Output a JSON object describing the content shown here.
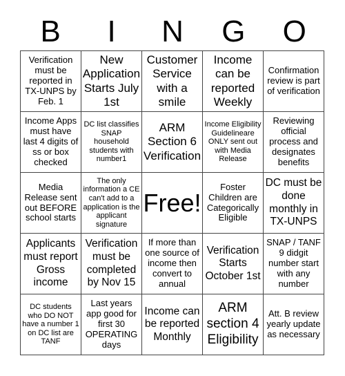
{
  "header": [
    "B",
    "I",
    "N",
    "G",
    "O"
  ],
  "cells": [
    "Verification must be reported in TX-UNPS by Feb. 1",
    "New Application Starts July 1st",
    "Customer Service with a smile",
    "Income can be reported Weekly",
    "Confirmation review is part of verification",
    "Income Apps must have last 4 digits of ss or box checked",
    "DC list classifies SNAP household students with number1",
    "ARM Section 6 Verification",
    "Income Eligibility Guidelineare ONLY sent out with Media Release",
    "Reviewing official process and designates benefits",
    "Media Release sent out BEFORE school starts",
    "The only information a CE can't add to a application is the applicant signature",
    "Free!",
    "Foster Children are Categorically Eligible",
    "DC must be done monthly in TX-UNPS",
    "Applicants must report Gross income",
    "Verification must be completed by Nov 15",
    "If more than one source of income then convert to annual",
    "Verification Starts October 1st",
    "SNAP / TANF 9 didgit number start with any number",
    "DC students who DO NOT have a number 1 on DC list are TANF",
    "Last years app good for first 30 OPERATING days",
    "Income can be reported Monthly",
    "ARM section 4 Eligibility",
    "Att. B review yearly update as necessary"
  ]
}
